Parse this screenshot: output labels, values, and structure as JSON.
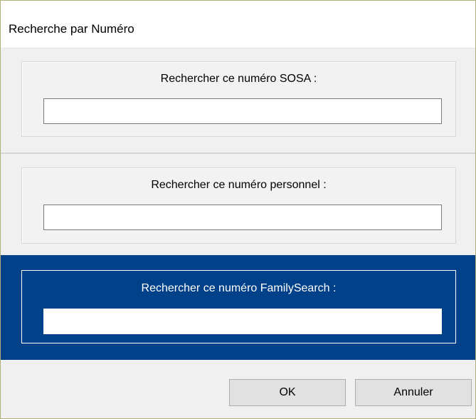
{
  "window": {
    "title": "Recherche par Numéro"
  },
  "sections": [
    {
      "label": "Rechercher ce numéro SOSA :",
      "value": ""
    },
    {
      "label": "Rechercher ce numéro personnel :",
      "value": ""
    },
    {
      "label": "Rechercher ce numéro FamilySearch :",
      "value": "",
      "selected": true
    }
  ],
  "buttons": {
    "ok": "OK",
    "cancel": "Annuler"
  },
  "colors": {
    "selected_background": "#00418a",
    "window_background": "#f0f0f0",
    "border": "#b2b07a"
  }
}
